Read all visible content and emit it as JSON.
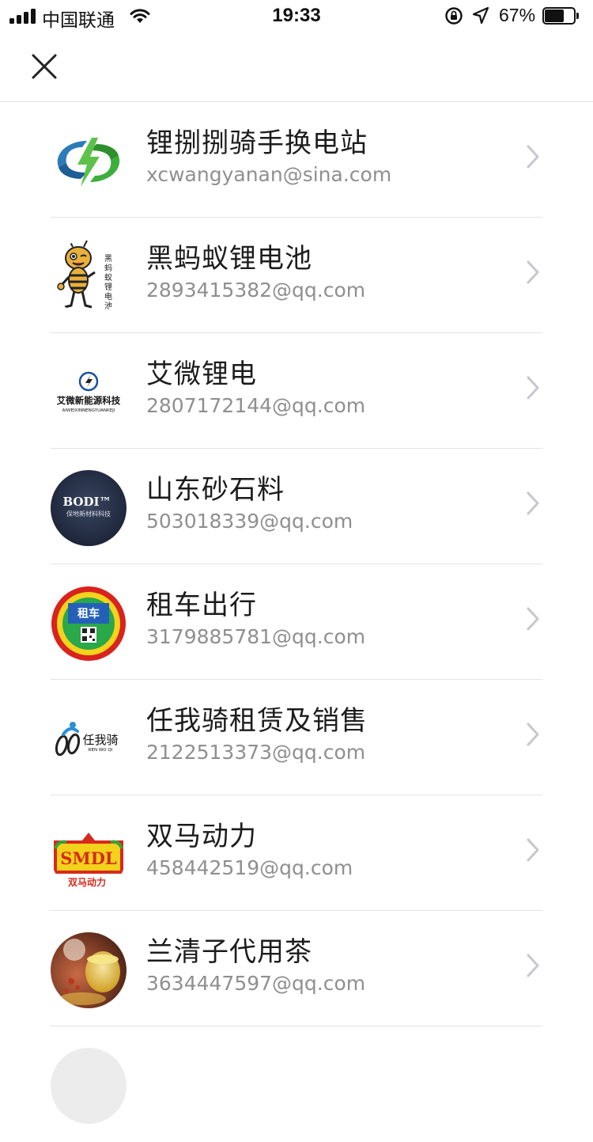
{
  "status_bar": {
    "carrier": "中国联通",
    "time": "19:33",
    "battery_percent": "67%",
    "battery_level": 0.67,
    "icons": [
      "signal-icon",
      "wifi-icon",
      "rotation-lock-icon",
      "location-icon",
      "battery-icon"
    ]
  },
  "nav": {
    "close_icon": "close-icon"
  },
  "contacts": [
    {
      "name": "锂捌捌骑手换电站",
      "email": "xcwangyanan@sina.com",
      "avatar": "lightning-logo"
    },
    {
      "name": "黑蚂蚁锂电池",
      "email": "2893415382@qq.com",
      "avatar": "ant-mascot-logo",
      "avatar_text": "黑蚂蚁锂电池"
    },
    {
      "name": "艾微锂电",
      "email": "2807172144@qq.com",
      "avatar": "aiwei-logo",
      "avatar_text": "艾微新能源科技",
      "avatar_subtext": "AIWEIXINNENGYUANKEJI"
    },
    {
      "name": "山东砂石料",
      "email": "503018339@qq.com",
      "avatar": "bodi-logo",
      "avatar_text": "BODI™",
      "avatar_subtext": "保地新材料科技"
    },
    {
      "name": "租车出行",
      "email": "3179885781@qq.com",
      "avatar": "rental-badge-logo",
      "avatar_text": "租车"
    },
    {
      "name": "任我骑租赁及销售",
      "email": "2122513373@qq.com",
      "avatar": "renwoqi-logo",
      "avatar_text": "任我骑",
      "avatar_subtext": "REN WO QI"
    },
    {
      "name": "双马动力",
      "email": "458442519@qq.com",
      "avatar": "smdl-logo",
      "avatar_text": "SMDL",
      "avatar_subtext": "双马动力"
    },
    {
      "name": "兰清子代用茶",
      "email": "3634447597@qq.com",
      "avatar": "tea-photo"
    },
    {
      "name": "",
      "email": "",
      "avatar": "partial-avatar"
    }
  ],
  "colors": {
    "text_primary": "#1c1c1c",
    "text_secondary": "#8f8f8f",
    "divider": "#e3e3e3",
    "chevron": "#c7c7cc"
  }
}
